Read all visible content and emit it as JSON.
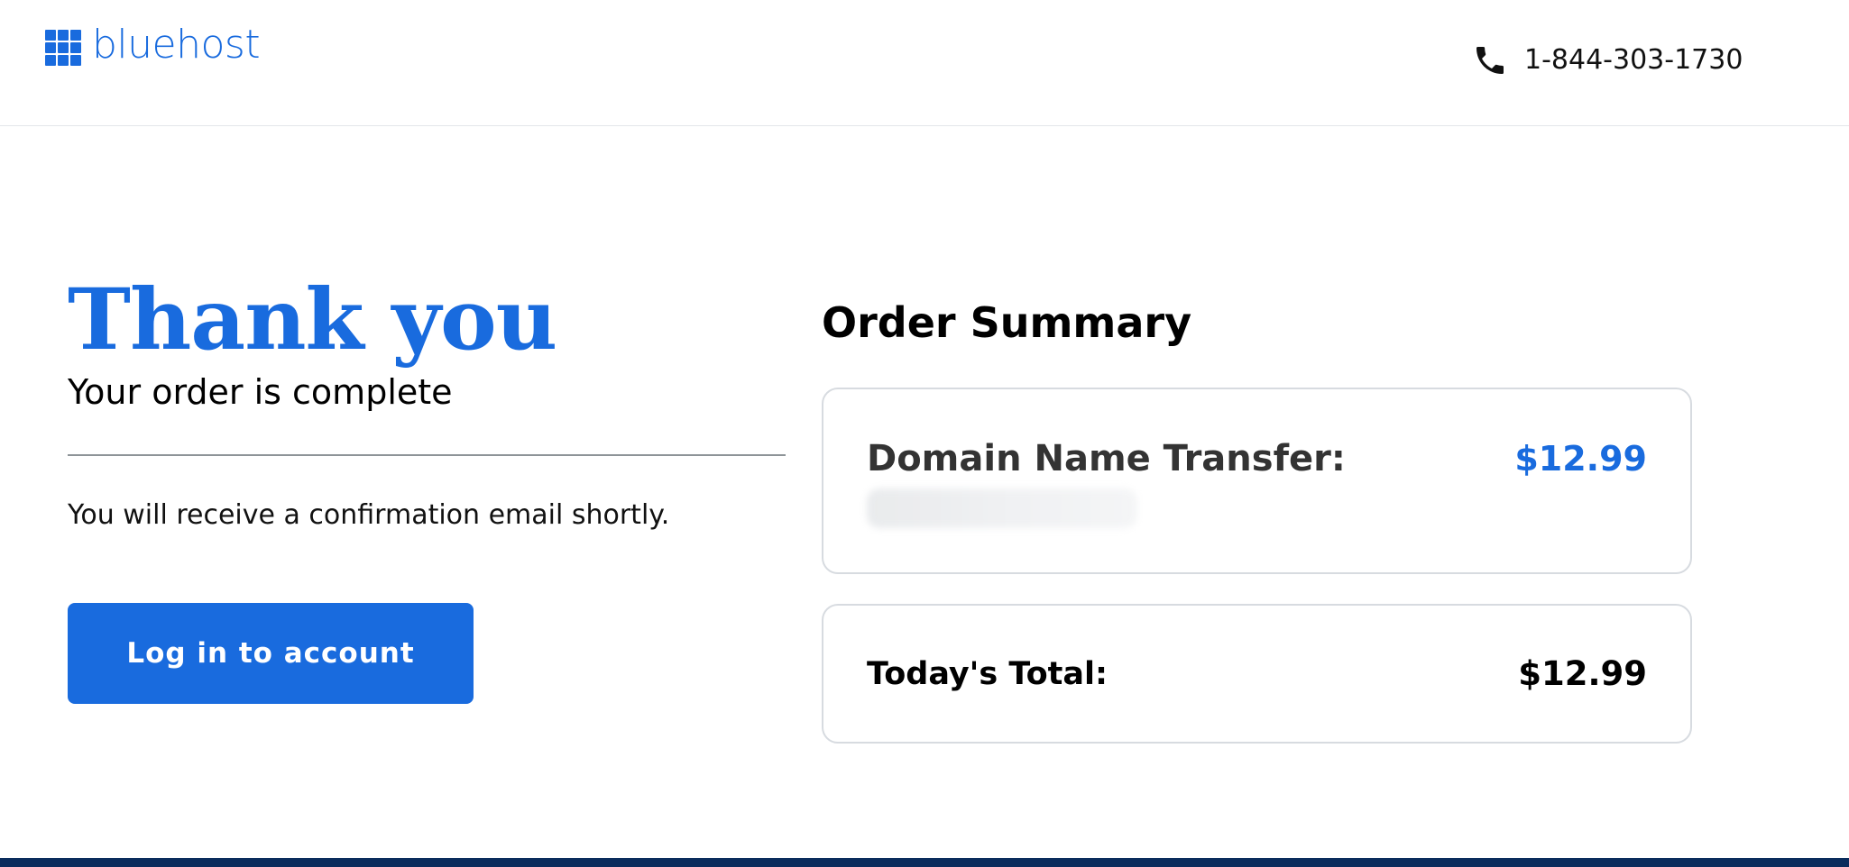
{
  "header": {
    "brand": "bluehost",
    "phone": "1-844-303-1730",
    "icons": {
      "logo": "grid-logo-icon",
      "phone": "phone-icon"
    }
  },
  "main": {
    "heading": "Thank you",
    "subheading": "Your order is complete",
    "confirmation": "You will receive a confirmation email shortly.",
    "login_button": "Log in to account"
  },
  "order_summary": {
    "title": "Order Summary",
    "items": [
      {
        "label": "Domain Name Transfer:",
        "price": "$12.99"
      }
    ],
    "total_label": "Today's Total:",
    "total_price": "$12.99"
  },
  "colors": {
    "brand_blue": "#196bde",
    "footer_navy": "#0a2c5c",
    "text": "#000000"
  }
}
